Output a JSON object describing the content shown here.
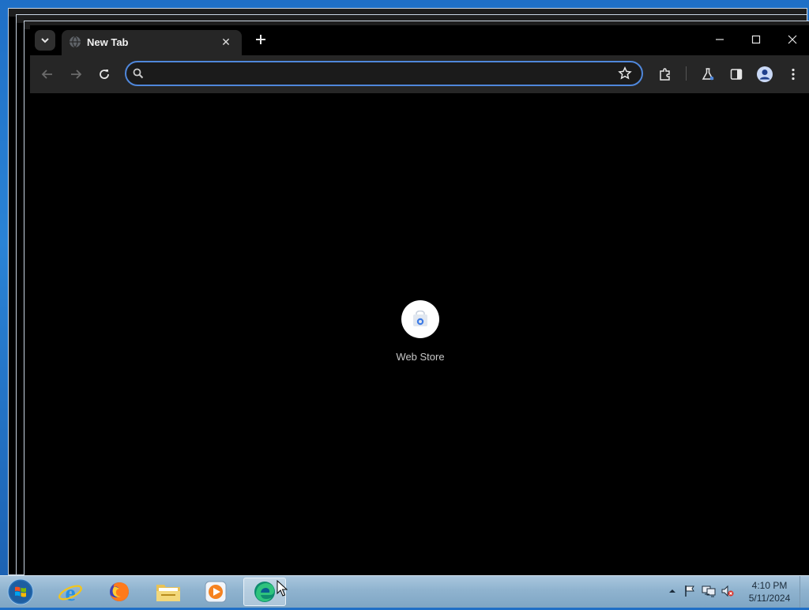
{
  "browser": {
    "tab": {
      "title": "New Tab"
    },
    "omnibox": {
      "value": "",
      "placeholder": ""
    },
    "new_tab_page": {
      "shortcuts": [
        {
          "label": "Web Store"
        }
      ]
    },
    "colors": {
      "accent": "#4f87db",
      "toolbar_bg": "#262626",
      "page_bg": "#000000"
    }
  },
  "taskbar": {
    "pinned": [
      {
        "name": "internet-explorer-icon"
      },
      {
        "name": "firefox-icon"
      },
      {
        "name": "file-explorer-icon"
      },
      {
        "name": "media-player-icon"
      },
      {
        "name": "edge-icon"
      }
    ],
    "clock": {
      "time": "4:10 PM",
      "date": "5/11/2024"
    }
  }
}
